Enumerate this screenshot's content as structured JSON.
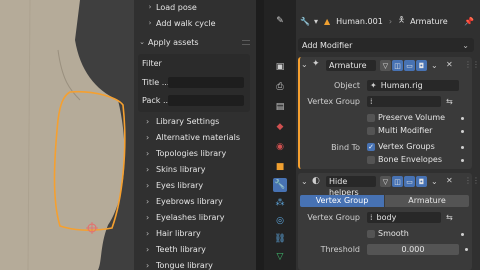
{
  "nav": {
    "load_pose": "Load pose",
    "add_walk_cycle": "Add walk cycle",
    "apply_assets": "Apply assets",
    "filter": "Filter",
    "title_label": "Title ...",
    "pack_label": "Pack ...",
    "items": [
      "Library Settings",
      "Alternative materials",
      "Topologies library",
      "Skins library",
      "Eyes library",
      "Eyebrows library",
      "Eyelashes library",
      "Hair library",
      "Teeth library",
      "Tongue library"
    ]
  },
  "header": {
    "object_name": "Human.001",
    "armature": "Armature"
  },
  "add_modifier": "Add Modifier",
  "armature_mod": {
    "name": "Armature",
    "object_label": "Object",
    "object_value": "Human.rig",
    "vgroup_label": "Vertex Group",
    "vgroup_value": "",
    "preserve_volume": "Preserve Volume",
    "multi_modifier": "Multi Modifier",
    "bind_to_label": "Bind To",
    "vertex_groups": "Vertex Groups",
    "bone_envelopes": "Bone Envelopes"
  },
  "mask_mod": {
    "name": "Hide helpers",
    "tab_vgroup": "Vertex Group",
    "tab_armature": "Armature",
    "vgroup_label": "Vertex Group",
    "vgroup_value": "body",
    "smooth": "Smooth",
    "threshold_label": "Threshold",
    "threshold_value": "0.000"
  },
  "colors": {
    "accent": "#4772b3",
    "selection": "#f5a030"
  }
}
